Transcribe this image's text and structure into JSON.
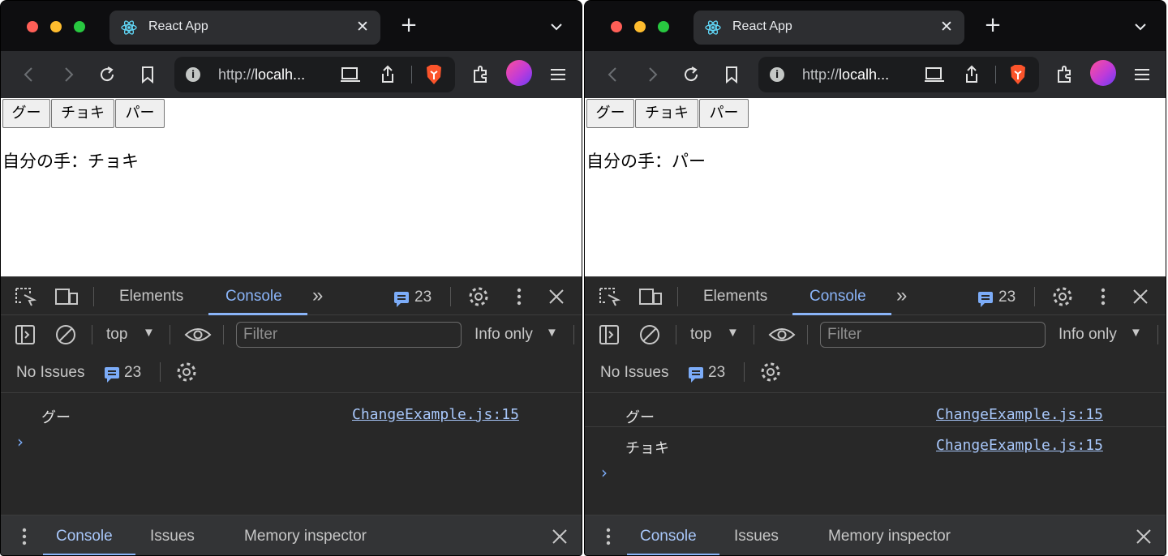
{
  "windows": [
    {
      "tab_title": "React App",
      "url_prefix": "http://",
      "url_host": "localh...",
      "buttons": [
        "グー",
        "チョキ",
        "パー"
      ],
      "hand_text": "自分の手：チョキ",
      "devtools": {
        "tabs": [
          "Elements",
          "Console"
        ],
        "active_tab": "Console",
        "more_tabs": "»",
        "message_count": "23",
        "context": "top",
        "filter_placeholder": "Filter",
        "level": "Info only",
        "issues_label": "No Issues",
        "issues_count": "23",
        "logs": [
          {
            "message": "グー",
            "source": "ChangeExample.js:15"
          }
        ],
        "drawer_tabs": [
          "Console",
          "Issues",
          "Memory inspector"
        ]
      }
    },
    {
      "tab_title": "React App",
      "url_prefix": "http://",
      "url_host": "localh...",
      "buttons": [
        "グー",
        "チョキ",
        "パー"
      ],
      "hand_text": "自分の手：パー",
      "devtools": {
        "tabs": [
          "Elements",
          "Console"
        ],
        "active_tab": "Console",
        "more_tabs": "»",
        "message_count": "23",
        "context": "top",
        "filter_placeholder": "Filter",
        "level": "Info only",
        "issues_label": "No Issues",
        "issues_count": "23",
        "logs": [
          {
            "message": "グー",
            "source": "ChangeExample.js:15"
          },
          {
            "message": "チョキ",
            "source": "ChangeExample.js:15"
          }
        ],
        "drawer_tabs": [
          "Console",
          "Issues",
          "Memory inspector"
        ]
      }
    }
  ],
  "colors": {
    "accent": "#8ab4f8",
    "link": "#a8c7fa",
    "devtools_bg": "#282828",
    "tab_strip_bg": "#0e0e10"
  }
}
